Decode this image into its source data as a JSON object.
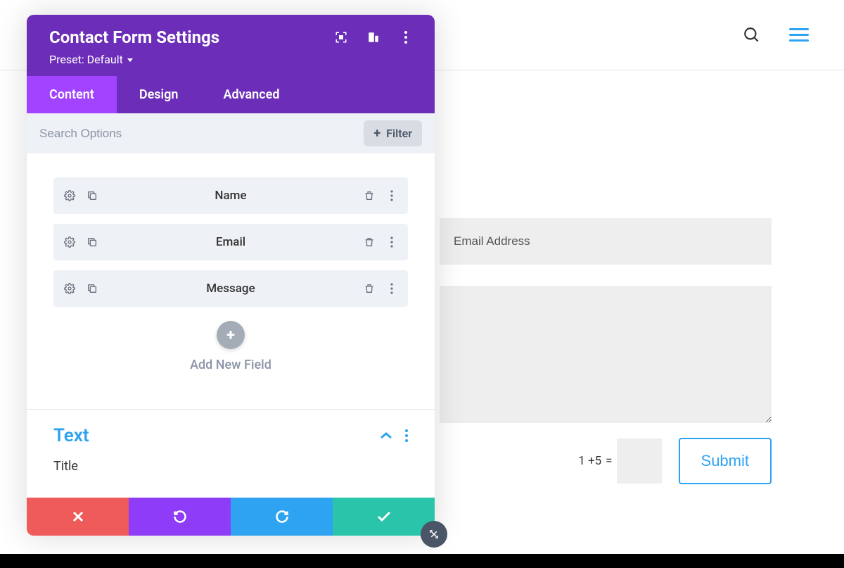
{
  "page": {
    "topbar": {}
  },
  "modal": {
    "title": "Contact Form Settings",
    "preset_label": "Preset: Default",
    "tabs": [
      {
        "label": "Content",
        "active": true
      },
      {
        "label": "Design",
        "active": false
      },
      {
        "label": "Advanced",
        "active": false
      }
    ],
    "search_placeholder": "Search Options",
    "filter_label": "Filter",
    "fields": [
      {
        "label": "Name"
      },
      {
        "label": "Email"
      },
      {
        "label": "Message"
      }
    ],
    "add_field_label": "Add New Field",
    "text_section": {
      "heading": "Text",
      "title_label": "Title"
    }
  },
  "form_preview": {
    "email_placeholder": "Email Address",
    "captcha_question": "1 +5",
    "captcha_equals": "=",
    "submit_label": "Submit"
  },
  "colors": {
    "primary_purple": "#6c2eb9",
    "active_purple": "#a143ff",
    "blue": "#2ea3f2",
    "teal": "#29c4a9",
    "red": "#ef5a5a"
  }
}
